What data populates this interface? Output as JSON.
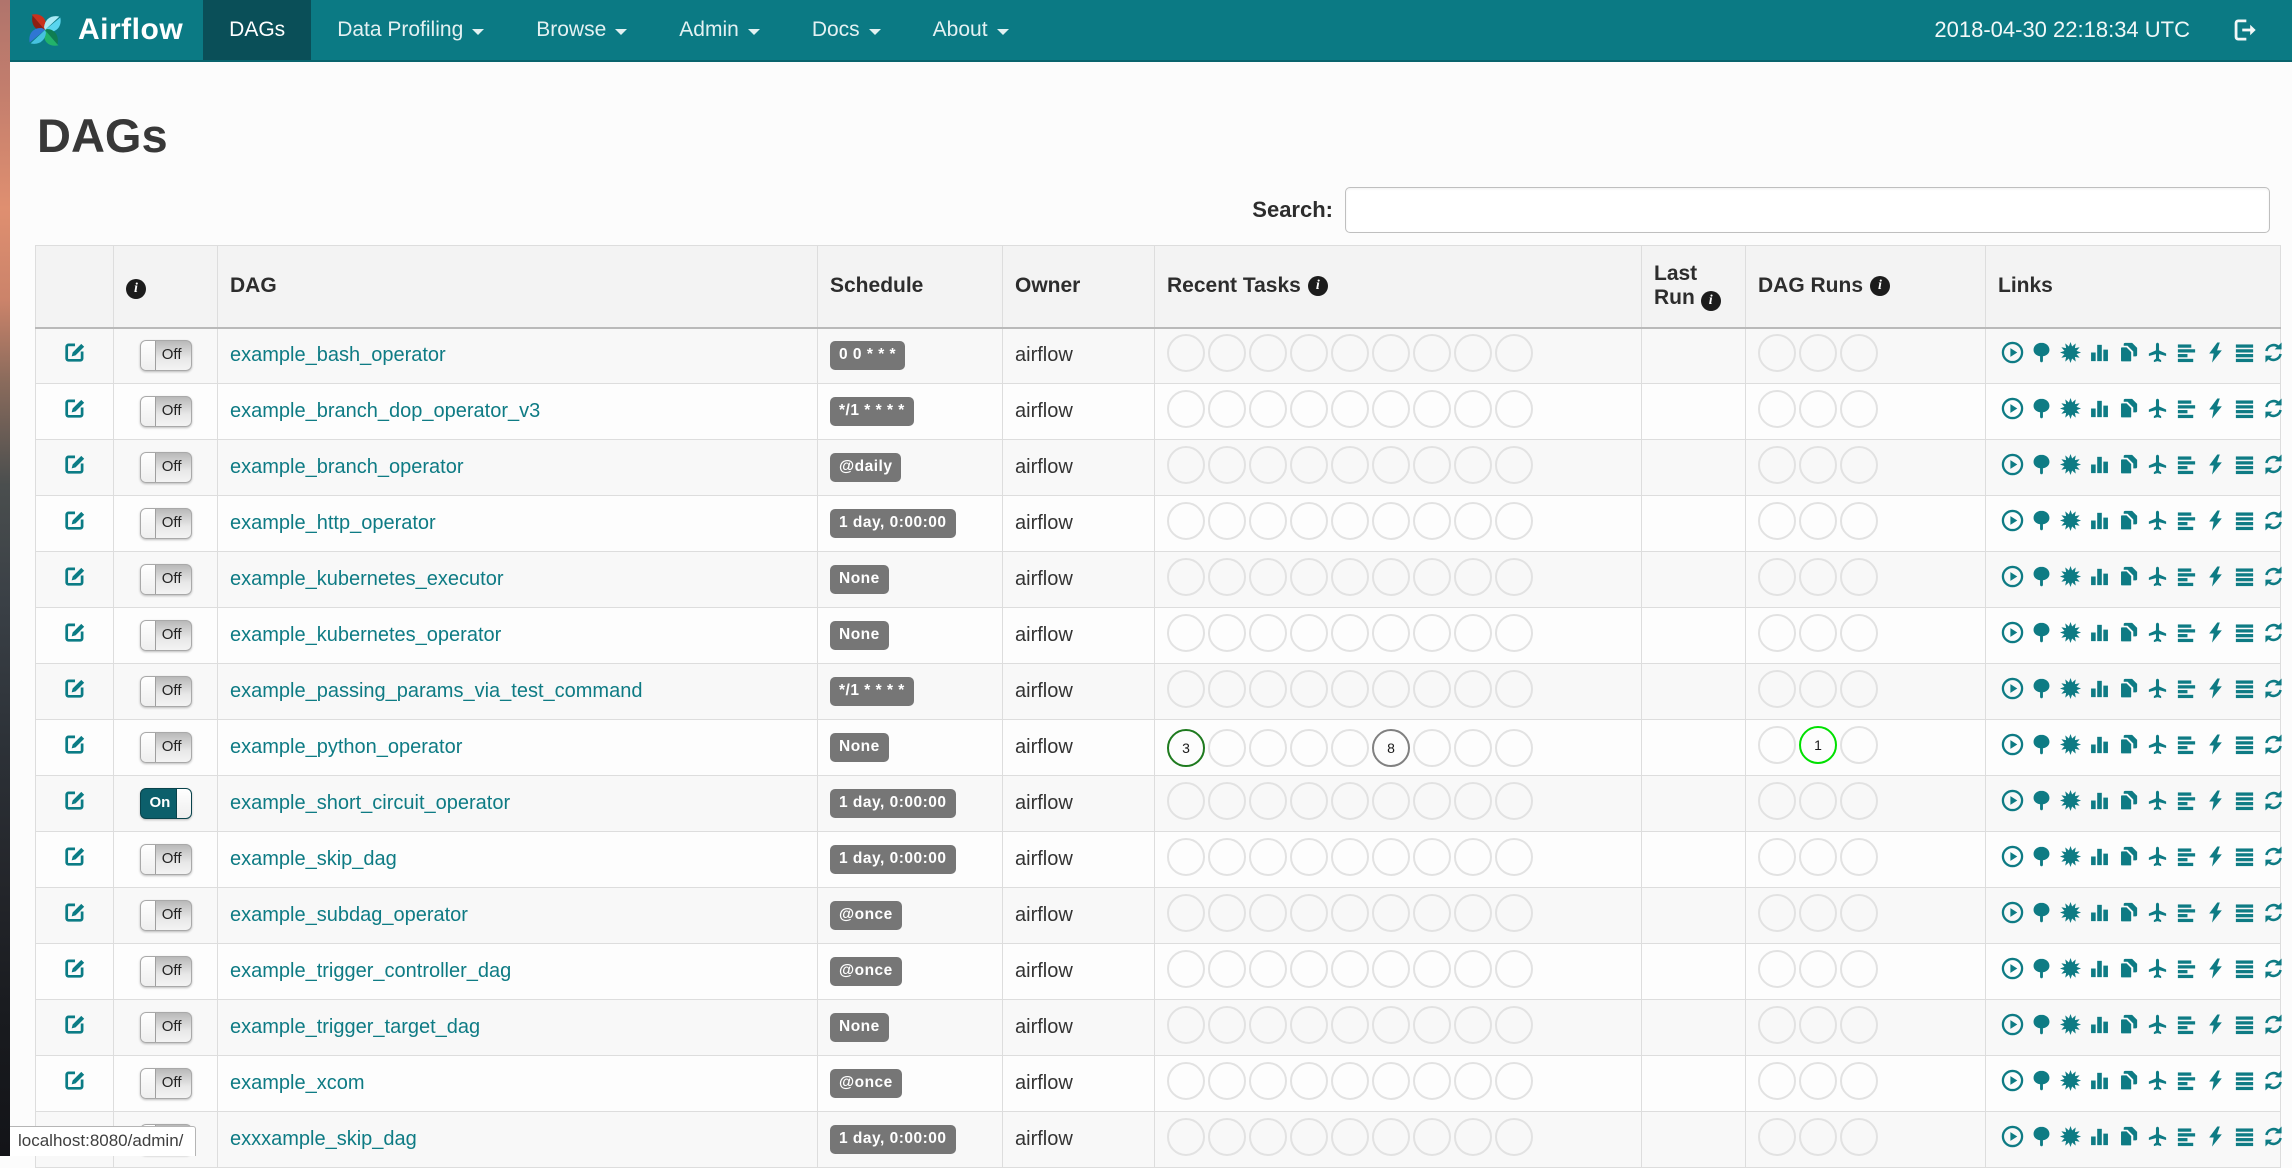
{
  "navbar": {
    "brand": "Airflow",
    "items": [
      {
        "label": "DAGs",
        "active": true,
        "caret": false
      },
      {
        "label": "Data Profiling",
        "active": false,
        "caret": true
      },
      {
        "label": "Browse",
        "active": false,
        "caret": true
      },
      {
        "label": "Admin",
        "active": false,
        "caret": true
      },
      {
        "label": "Docs",
        "active": false,
        "caret": true
      },
      {
        "label": "About",
        "active": false,
        "caret": true
      }
    ],
    "clock": "2018-04-30 22:18:34 UTC"
  },
  "page": {
    "title": "DAGs"
  },
  "search": {
    "label": "Search:",
    "value": ""
  },
  "colors": {
    "navbar_bg": "#0b7a84",
    "navbar_active_bg": "#0a4f58",
    "accent_teal": "#0e7b84",
    "badge_gray": "#767676",
    "state_success": "#1e7a1e",
    "state_gray": "#808080",
    "state_running": "#00e000",
    "circle_empty_border": "#e2e2e2"
  },
  "table": {
    "headers": {
      "edit": "",
      "info": "",
      "dag": "DAG",
      "schedule": "Schedule",
      "owner": "Owner",
      "recent_tasks": "Recent Tasks",
      "last_run": "Last Run",
      "dag_runs": "DAG Runs",
      "links": "Links"
    },
    "recent_tasks_slots": 9,
    "dag_runs_slots": 3,
    "link_icons": [
      "trigger-dag",
      "tree-view",
      "graph-view",
      "task-duration",
      "task-tries",
      "landing-times",
      "gantt-view",
      "code-view",
      "task-details",
      "refresh"
    ],
    "rows": [
      {
        "dag": "example_bash_operator",
        "toggle": "Off",
        "schedule": "0 0 * * *",
        "owner": "airflow",
        "last_run": "",
        "recent_tasks": {},
        "dag_runs": {}
      },
      {
        "dag": "example_branch_dop_operator_v3",
        "toggle": "Off",
        "schedule": "*/1 * * * *",
        "owner": "airflow",
        "last_run": "",
        "recent_tasks": {},
        "dag_runs": {}
      },
      {
        "dag": "example_branch_operator",
        "toggle": "Off",
        "schedule": "@daily",
        "owner": "airflow",
        "last_run": "",
        "recent_tasks": {},
        "dag_runs": {}
      },
      {
        "dag": "example_http_operator",
        "toggle": "Off",
        "schedule": "1 day, 0:00:00",
        "owner": "airflow",
        "last_run": "",
        "recent_tasks": {},
        "dag_runs": {}
      },
      {
        "dag": "example_kubernetes_executor",
        "toggle": "Off",
        "schedule": "None",
        "owner": "airflow",
        "last_run": "",
        "recent_tasks": {},
        "dag_runs": {}
      },
      {
        "dag": "example_kubernetes_operator",
        "toggle": "Off",
        "schedule": "None",
        "owner": "airflow",
        "last_run": "",
        "recent_tasks": {},
        "dag_runs": {}
      },
      {
        "dag": "example_passing_params_via_test_command",
        "toggle": "Off",
        "schedule": "*/1 * * * *",
        "owner": "airflow",
        "last_run": "",
        "recent_tasks": {},
        "dag_runs": {}
      },
      {
        "dag": "example_python_operator",
        "toggle": "Off",
        "schedule": "None",
        "owner": "airflow",
        "last_run": "",
        "recent_tasks": {
          "0": {
            "count": "3",
            "color": "#1e7a1e"
          },
          "5": {
            "count": "8",
            "color": "#808080"
          }
        },
        "dag_runs": {
          "1": {
            "count": "1",
            "color": "#00e000"
          }
        }
      },
      {
        "dag": "example_short_circuit_operator",
        "toggle": "On",
        "schedule": "1 day, 0:00:00",
        "owner": "airflow",
        "last_run": "",
        "recent_tasks": {},
        "dag_runs": {}
      },
      {
        "dag": "example_skip_dag",
        "toggle": "Off",
        "schedule": "1 day, 0:00:00",
        "owner": "airflow",
        "last_run": "",
        "recent_tasks": {},
        "dag_runs": {}
      },
      {
        "dag": "example_subdag_operator",
        "toggle": "Off",
        "schedule": "@once",
        "owner": "airflow",
        "last_run": "",
        "recent_tasks": {},
        "dag_runs": {}
      },
      {
        "dag": "example_trigger_controller_dag",
        "toggle": "Off",
        "schedule": "@once",
        "owner": "airflow",
        "last_run": "",
        "recent_tasks": {},
        "dag_runs": {}
      },
      {
        "dag": "example_trigger_target_dag",
        "toggle": "Off",
        "schedule": "None",
        "owner": "airflow",
        "last_run": "",
        "recent_tasks": {},
        "dag_runs": {}
      },
      {
        "dag": "example_xcom",
        "toggle": "Off",
        "schedule": "@once",
        "owner": "airflow",
        "last_run": "",
        "recent_tasks": {},
        "dag_runs": {}
      },
      {
        "dag": "exxxample_skip_dag",
        "toggle": "Off",
        "schedule": "1 day, 0:00:00",
        "owner": "airflow",
        "last_run": "",
        "recent_tasks": {},
        "dag_runs": {}
      }
    ]
  },
  "statusbar": {
    "url": "localhost:8080/admin/"
  }
}
